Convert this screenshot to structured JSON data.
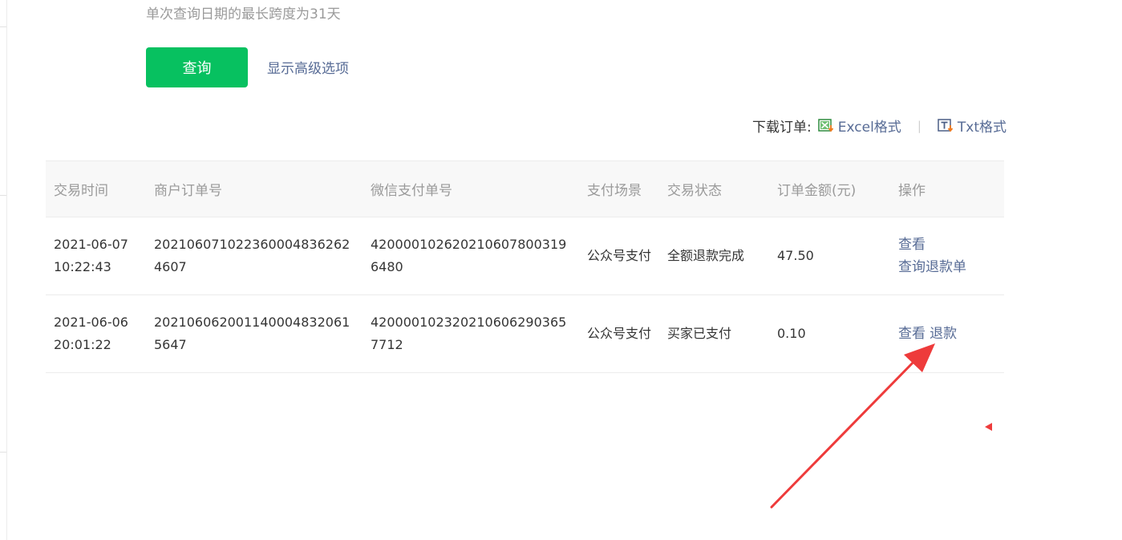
{
  "search": {
    "date_range_hint": "单次查询日期的最长跨度为31天",
    "query_button": "查询",
    "advanced_toggle": "显示高级选项"
  },
  "download": {
    "label": "下载订单:",
    "excel": "Excel格式",
    "separator": "|",
    "txt": "Txt格式"
  },
  "table": {
    "headers": [
      "交易时间",
      "商户订单号",
      "微信支付单号",
      "支付场景",
      "交易状态",
      "订单金额(元)",
      "操作"
    ],
    "rows": [
      {
        "time": "2021-06-07 10:22:43",
        "merchant_order_no": "202106071022360004836262 4607",
        "wechat_pay_no": "4200001026202106078003196480",
        "scene": "公众号支付",
        "status": "全额退款完成",
        "amount": "47.50",
        "actions": [
          "查看",
          "查询退款单"
        ]
      },
      {
        "time": "2021-06-06 20:01:22",
        "merchant_order_no": "202106062001140004832061 5647",
        "wechat_pay_no": "4200001023202106062903657712",
        "scene": "公众号支付",
        "status": "买家已支付",
        "amount": "0.10",
        "actions": [
          "查看",
          "退款"
        ]
      }
    ]
  },
  "colors": {
    "primary_green": "#07c160",
    "link_blue": "#576b95",
    "annotation_red": "#ee3b3b"
  },
  "icons": {
    "excel": "excel-file-icon",
    "txt": "txt-file-icon"
  }
}
